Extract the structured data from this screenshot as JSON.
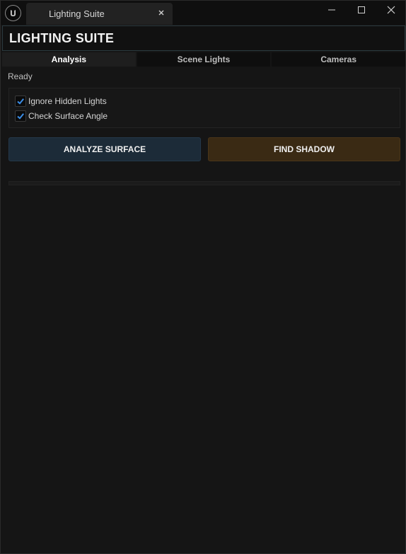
{
  "window": {
    "tab_title": "Lighting Suite",
    "app_icon": "unreal-logo-icon",
    "controls": {
      "minimize": "minimize-icon",
      "maximize": "maximize-icon",
      "close": "close-icon"
    }
  },
  "header": {
    "title": "LIGHTING SUITE"
  },
  "tabs": [
    {
      "label": "Analysis",
      "active": true
    },
    {
      "label": "Scene Lights",
      "active": false
    },
    {
      "label": "Cameras",
      "active": false
    }
  ],
  "status": {
    "text": "Ready"
  },
  "options": [
    {
      "label": "Ignore Hidden Lights",
      "checked": true
    },
    {
      "label": "Check Surface Angle",
      "checked": true
    }
  ],
  "actions": {
    "analyze_label": "ANALYZE SURFACE",
    "shadow_label": "FIND SHADOW"
  },
  "progress": {
    "value": 0
  },
  "colors": {
    "accent": "#2c6fb8",
    "checkmark": "#3b8ee8",
    "analyze_bg": "#1c2b38",
    "shadow_bg": "#3a2a14"
  }
}
